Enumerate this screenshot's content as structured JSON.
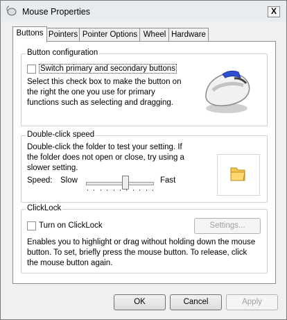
{
  "window": {
    "title": "Mouse Properties",
    "close_label": "X"
  },
  "tabs": [
    {
      "label": "Buttons"
    },
    {
      "label": "Pointers"
    },
    {
      "label": "Pointer Options"
    },
    {
      "label": "Wheel"
    },
    {
      "label": "Hardware"
    }
  ],
  "button_config": {
    "legend": "Button configuration",
    "checkbox_label": "Switch primary and secondary buttons",
    "description": "Select this check box to make the button on the right the one you use for primary functions such as selecting and dragging."
  },
  "double_click": {
    "legend": "Double-click speed",
    "description": "Double-click the folder to test your setting. If the folder does not open or close, try using a slower setting.",
    "speed_label": "Speed:",
    "slow_label": "Slow",
    "fast_label": "Fast",
    "speed_level": 0.58
  },
  "clicklock": {
    "legend": "ClickLock",
    "checkbox_label": "Turn on ClickLock",
    "settings_label": "Settings...",
    "description": "Enables you to highlight or drag without holding down the mouse button. To set, briefly press the mouse button. To release, click the mouse button again."
  },
  "footer": {
    "ok_label": "OK",
    "cancel_label": "Cancel",
    "apply_label": "Apply"
  },
  "icons": {
    "title": "mouse-icon",
    "mouse_graphic": "mouse-icon",
    "folder": "folder-icon"
  }
}
